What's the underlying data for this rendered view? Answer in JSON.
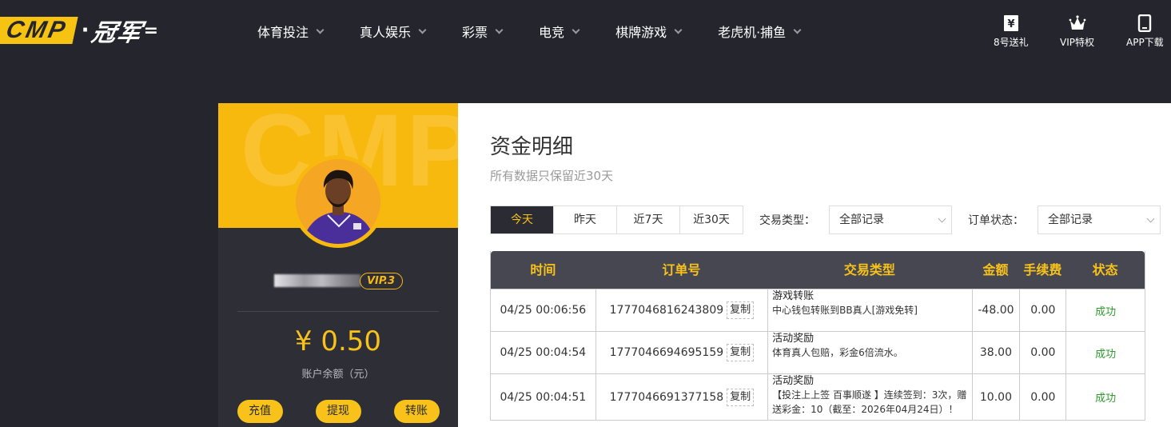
{
  "logo": {
    "mark": "CMP",
    "dot": "·",
    "name": "冠军",
    "tail": "="
  },
  "nav": {
    "items": [
      {
        "label": "体育投注"
      },
      {
        "label": "真人娱乐"
      },
      {
        "label": "彩票"
      },
      {
        "label": "电竞"
      },
      {
        "label": "棋牌游戏"
      },
      {
        "label": "老虎机·捕鱼"
      }
    ]
  },
  "quick_links": [
    {
      "label": "8号送礼",
      "icon": "yen-ticket-icon"
    },
    {
      "label": "VIP特权",
      "icon": "crown-icon"
    },
    {
      "label": "APP下载",
      "icon": "phone-icon"
    }
  ],
  "profile": {
    "watermark": "CMP",
    "vip_badge": "VIP.3",
    "balance": "¥ 0.50",
    "balance_label": "账户余额（元）",
    "actions": [
      {
        "label": "充值"
      },
      {
        "label": "提现"
      },
      {
        "label": "转账"
      }
    ]
  },
  "panel": {
    "title": "资金明细",
    "subtitle": "所有数据只保留近30天",
    "date_tabs": [
      {
        "label": "今天",
        "active": true
      },
      {
        "label": "昨天",
        "active": false
      },
      {
        "label": "近7天",
        "active": false
      },
      {
        "label": "近30天",
        "active": false
      }
    ],
    "type_filter": {
      "label": "交易类型：",
      "value": "全部记录"
    },
    "status_filter": {
      "label": "订单状态：",
      "value": "全部记录"
    }
  },
  "table": {
    "columns": [
      "时间",
      "订单号",
      "交易类型",
      "金额",
      "手续费",
      "状态"
    ],
    "copy_label": "复制",
    "rows": [
      {
        "time": "04/25 00:06:56",
        "order": "1777046816243809",
        "type": "游戏转账",
        "desc": "中心钱包转账到BB真人[游戏免转]",
        "desc2": "",
        "amount": "-48.00",
        "fee": "0.00",
        "status": "成功"
      },
      {
        "time": "04/25 00:04:54",
        "order": "1777046694695159",
        "type": "活动奖励",
        "desc": "体育真人包赔，彩金6倍流水。",
        "desc2": "",
        "amount": "38.00",
        "fee": "0.00",
        "status": "成功"
      },
      {
        "time": "04/25 00:04:51",
        "order": "1777046691377158",
        "type": "活动奖励",
        "desc": "【投注上上签 百事顺遂 】连续签到：3次，赠",
        "desc2": "送彩金：10（截至：2026年04月24日）！",
        "amount": "10.00",
        "fee": "0.00",
        "status": "成功"
      }
    ]
  },
  "colors": {
    "accent": "#f8c21a",
    "dark": "#25252d",
    "header": "#474752",
    "success": "#2e9a2e"
  }
}
